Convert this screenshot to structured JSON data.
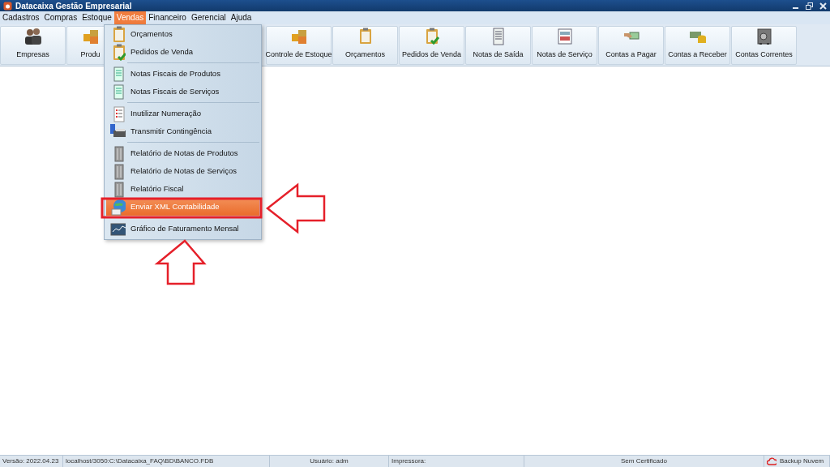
{
  "window": {
    "title": "Datacaixa Gestão Empresarial"
  },
  "menubar": [
    {
      "label": "Cadastros",
      "selected": false
    },
    {
      "label": "Compras",
      "selected": false
    },
    {
      "label": "Estoque",
      "selected": false
    },
    {
      "label": "Vendas",
      "selected": true
    },
    {
      "label": "Financeiro",
      "selected": false
    },
    {
      "label": "Gerencial",
      "selected": false
    },
    {
      "label": "Ajuda",
      "selected": false
    }
  ],
  "toolbar_left": [
    {
      "label": "Empresas"
    },
    {
      "label": "Produ"
    }
  ],
  "toolbar_right": [
    {
      "label": "Controle de Estoque"
    },
    {
      "label": "Orçamentos"
    },
    {
      "label": "Pedidos de Venda"
    },
    {
      "label": "Notas de Saída"
    },
    {
      "label": "Notas de Serviço"
    },
    {
      "label": "Contas a Pagar"
    },
    {
      "label": "Contas a Receber"
    },
    {
      "label": "Contas Correntes"
    }
  ],
  "menu": {
    "groups": [
      [
        {
          "label": "Orçamentos",
          "selected": false
        },
        {
          "label": "Pedidos de Venda",
          "selected": false
        }
      ],
      [
        {
          "label": "Notas Fiscais de Produtos",
          "selected": false
        },
        {
          "label": "Notas Fiscais de Serviços",
          "selected": false
        }
      ],
      [
        {
          "label": "Inutilizar Numeração",
          "selected": false
        },
        {
          "label": "Transmitir Contingência",
          "selected": false
        }
      ],
      [
        {
          "label": "Relatório de Notas de Produtos",
          "selected": false
        },
        {
          "label": "Relatório de Notas de Serviços",
          "selected": false
        },
        {
          "label": "Relatório Fiscal",
          "selected": false
        },
        {
          "label": "Enviar XML Contabilidade",
          "selected": true
        }
      ],
      [
        {
          "label": "Gráfico de Faturamento Mensal",
          "selected": false
        }
      ]
    ]
  },
  "status_bar": [
    {
      "text": "Versão: 2022.04.23"
    },
    {
      "text": "localhost/3050:C:\\Datacaixa_FAQ\\BD\\BANCO.FDB"
    },
    {
      "text": "Usuário: adm"
    },
    {
      "text": "Impressora:"
    },
    {
      "text": "Sem Certificado"
    },
    {
      "text": "Backup Nuvem"
    }
  ]
}
